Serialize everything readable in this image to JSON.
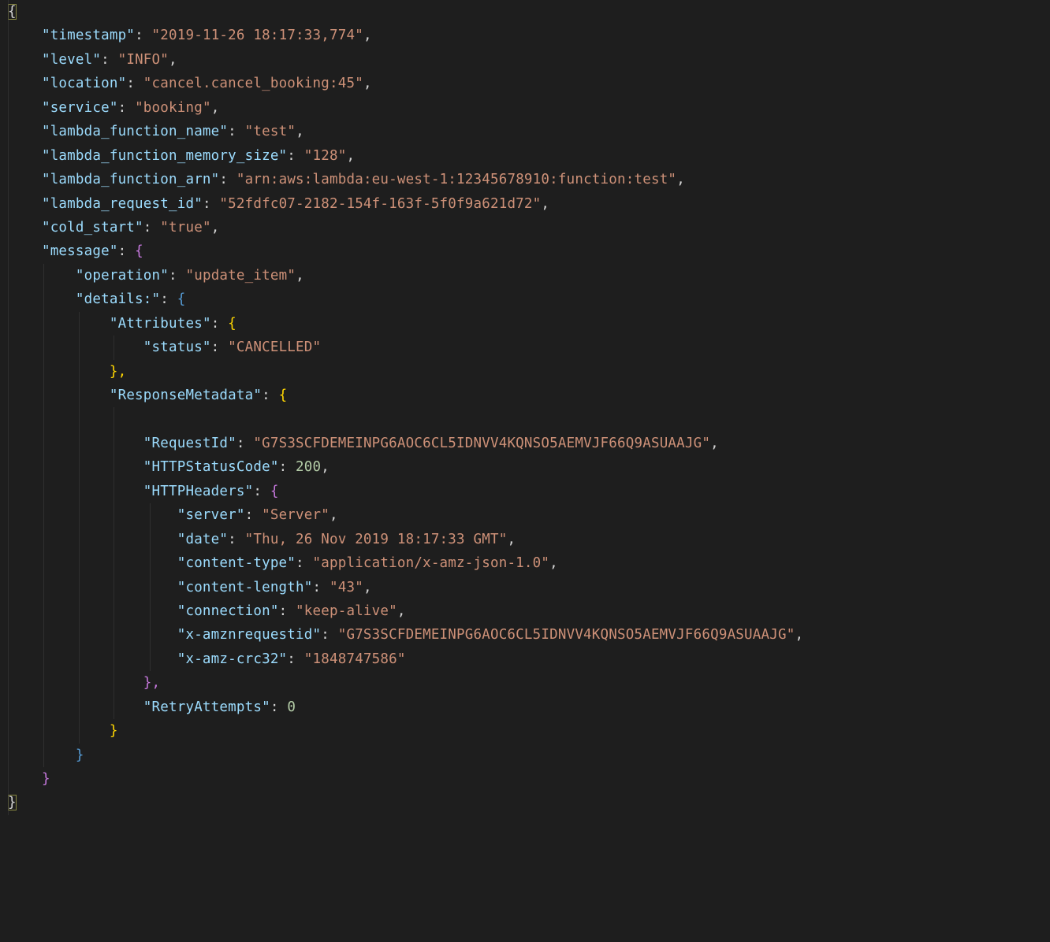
{
  "root": {
    "timestamp": {
      "k": "\"timestamp\"",
      "v": "\"2019-11-26 18:17:33,774\""
    },
    "level": {
      "k": "\"level\"",
      "v": "\"INFO\""
    },
    "location": {
      "k": "\"location\"",
      "v": "\"cancel.cancel_booking:45\""
    },
    "service": {
      "k": "\"service\"",
      "v": "\"booking\""
    },
    "lambda_function_name": {
      "k": "\"lambda_function_name\"",
      "v": "\"test\""
    },
    "lambda_function_memory_size": {
      "k": "\"lambda_function_memory_size\"",
      "v": "\"128\""
    },
    "lambda_function_arn": {
      "k": "\"lambda_function_arn\"",
      "v": "\"arn:aws:lambda:eu-west-1:12345678910:function:test\""
    },
    "lambda_request_id": {
      "k": "\"lambda_request_id\"",
      "v": "\"52fdfc07-2182-154f-163f-5f0f9a621d72\""
    },
    "cold_start": {
      "k": "\"cold_start\"",
      "v": "\"true\""
    },
    "message": {
      "k": "\"message\"",
      "operation": {
        "k": "\"operation\"",
        "v": "\"update_item\""
      },
      "details": {
        "k": "\"details:\"",
        "Attributes": {
          "k": "\"Attributes\"",
          "status": {
            "k": "\"status\"",
            "v": "\"CANCELLED\""
          }
        },
        "ResponseMetadata": {
          "k": "\"ResponseMetadata\"",
          "RequestId": {
            "k": "\"RequestId\"",
            "v": "\"G7S3SCFDEMEINPG6AOC6CL5IDNVV4KQNSO5AEMVJF66Q9ASUAAJG\""
          },
          "HTTPStatusCode": {
            "k": "\"HTTPStatusCode\"",
            "v": "200"
          },
          "HTTPHeaders": {
            "k": "\"HTTPHeaders\"",
            "server": {
              "k": "\"server\"",
              "v": "\"Server\""
            },
            "date": {
              "k": "\"date\"",
              "v": "\"Thu, 26 Nov 2019 18:17:33 GMT\""
            },
            "content_type": {
              "k": "\"content-type\"",
              "v": "\"application/x-amz-json-1.0\""
            },
            "content_length": {
              "k": "\"content-length\"",
              "v": "\"43\""
            },
            "connection": {
              "k": "\"connection\"",
              "v": "\"keep-alive\""
            },
            "x_amznrequestid": {
              "k": "\"x-amznrequestid\"",
              "v": "\"G7S3SCFDEMEINPG6AOC6CL5IDNVV4KQNSO5AEMVJF66Q9ASUAAJG\""
            },
            "x_amz_crc32": {
              "k": "\"x-amz-crc32\"",
              "v": "\"1848747586\""
            }
          },
          "RetryAttempts": {
            "k": "\"RetryAttempts\"",
            "v": "0"
          }
        }
      }
    }
  },
  "punct": {
    "open": "{",
    "close": "}",
    "colon_sp": ": ",
    "comma": ",",
    "close_comma": "},"
  }
}
